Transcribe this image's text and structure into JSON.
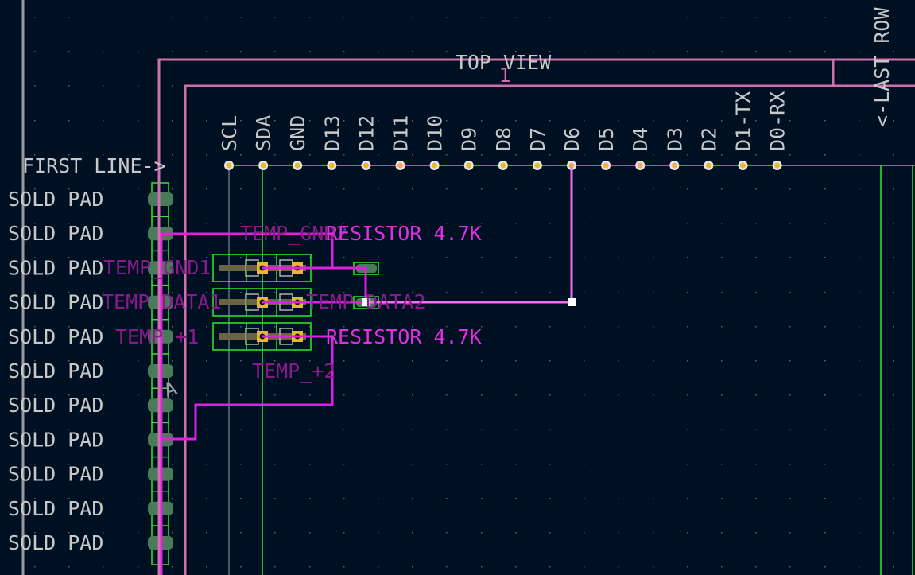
{
  "view_title": "TOP VIEW",
  "sheet_number": "1",
  "first_line_label": "FIRST LINE->",
  "last_row_label": "<-LAST ROW",
  "header_pins": [
    "SCL",
    "SDA",
    "GND",
    "D13",
    "D12",
    "D11",
    "D10",
    "D9",
    "D8",
    "D7",
    "D6",
    "D5",
    "D4",
    "D3",
    "D2",
    "D1-TX",
    "D0-RX"
  ],
  "solder_pads": [
    "SOLD PAD",
    "SOLD PAD",
    "SOLD PAD",
    "SOLD PAD",
    "SOLD PAD",
    "SOLD PAD",
    "SOLD PAD",
    "SOLD PAD",
    "SOLD PAD",
    "SOLD PAD",
    "SOLD PAD"
  ],
  "footprint_marker": "A",
  "labels": {
    "temp_gnd1": "TEMP_GND1",
    "temp_gnd2": "TEMP_GND2",
    "temp_data1": "TEMP_DATA1",
    "temp_data2": "TEMP_DATA2",
    "temp_p1": "TEMP_+1",
    "temp_p2": "TEMP_+2",
    "resistor_top": "RESISTOR 4.7K",
    "resistor_bottom": "RESISTOR 4.7K"
  },
  "colors": {
    "background": "#001023",
    "silkscreen": "#c8c8c8",
    "edge_cuts": "#d070b0",
    "trace": "#e020e0",
    "courtyard": "#2ee82e",
    "pad_smd": "#4a7a5a",
    "pad_tht": "#e8b830",
    "ref_text": "#8a1a8a",
    "value_text": "#e030e0"
  }
}
